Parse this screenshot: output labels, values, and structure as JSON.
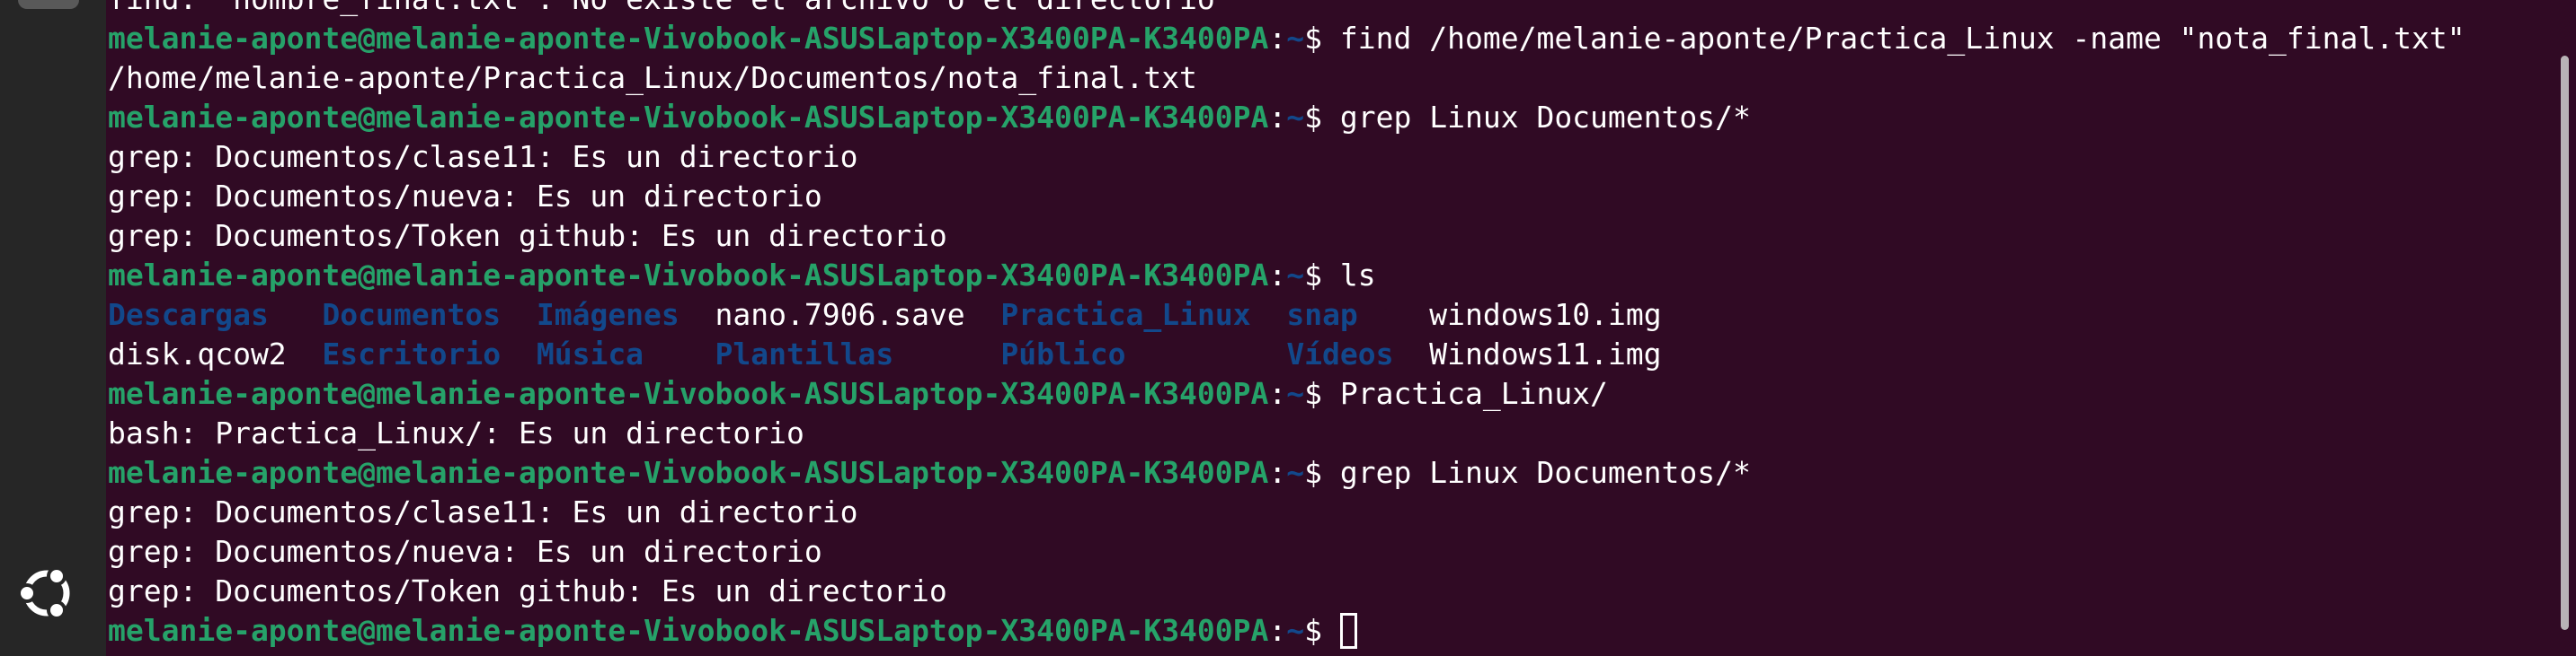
{
  "dock": {
    "apps_icon": "ubuntu-show-apps-icon"
  },
  "terminal": {
    "prompt": {
      "user_host": "melanie-aponte@melanie-aponte-Vivobook-ASUSLaptop-X3400PA-K3400PA",
      "path": "~",
      "symbol": "$ "
    },
    "lines": [
      {
        "type": "out",
        "text": "find: ‘nombre_final.txt’: No existe el archivo o el directorio"
      },
      {
        "type": "cmd",
        "command": "find /home/melanie-aponte/Practica_Linux -name \"nota_final.txt\""
      },
      {
        "type": "out",
        "text": "/home/melanie-aponte/Practica_Linux/Documentos/nota_final.txt"
      },
      {
        "type": "cmd",
        "command": "grep Linux Documentos/*"
      },
      {
        "type": "out",
        "text": "grep: Documentos/clase11: Es un directorio"
      },
      {
        "type": "out",
        "text": "grep: Documentos/nueva: Es un directorio"
      },
      {
        "type": "out",
        "text": "grep: Documentos/Token github: Es un directorio"
      },
      {
        "type": "cmd",
        "command": "ls"
      },
      {
        "type": "ls",
        "cells": [
          {
            "text": "Descargas   ",
            "dir": true
          },
          {
            "text": "Documentos  ",
            "dir": true
          },
          {
            "text": "Imágenes  ",
            "dir": true
          },
          {
            "text": "nano.7906.save  ",
            "dir": false
          },
          {
            "text": "Practica_Linux",
            "dir": true
          },
          {
            "text": "  ",
            "dir": false
          },
          {
            "text": "snap",
            "dir": true
          },
          {
            "text": "    windows10.img",
            "dir": false
          }
        ]
      },
      {
        "type": "ls",
        "cells": [
          {
            "text": "disk.qcow2  ",
            "dir": false
          },
          {
            "text": "Escritorio  ",
            "dir": true
          },
          {
            "text": "Música    ",
            "dir": true
          },
          {
            "text": "Plantillas      ",
            "dir": true
          },
          {
            "text": "Público",
            "dir": true
          },
          {
            "text": "         ",
            "dir": false
          },
          {
            "text": "Vídeos",
            "dir": true
          },
          {
            "text": "  Windows11.img",
            "dir": false
          }
        ]
      },
      {
        "type": "cmd",
        "command": "Practica_Linux/"
      },
      {
        "type": "out",
        "text": "bash: Practica_Linux/: Es un directorio"
      },
      {
        "type": "cmd",
        "command": "grep Linux Documentos/*"
      },
      {
        "type": "out",
        "text": "grep: Documentos/clase11: Es un directorio"
      },
      {
        "type": "out",
        "text": "grep: Documentos/nueva: Es un directorio"
      },
      {
        "type": "out",
        "text": "grep: Documentos/Token github: Es un directorio"
      },
      {
        "type": "cmd",
        "command": "",
        "cursor": true
      }
    ]
  }
}
